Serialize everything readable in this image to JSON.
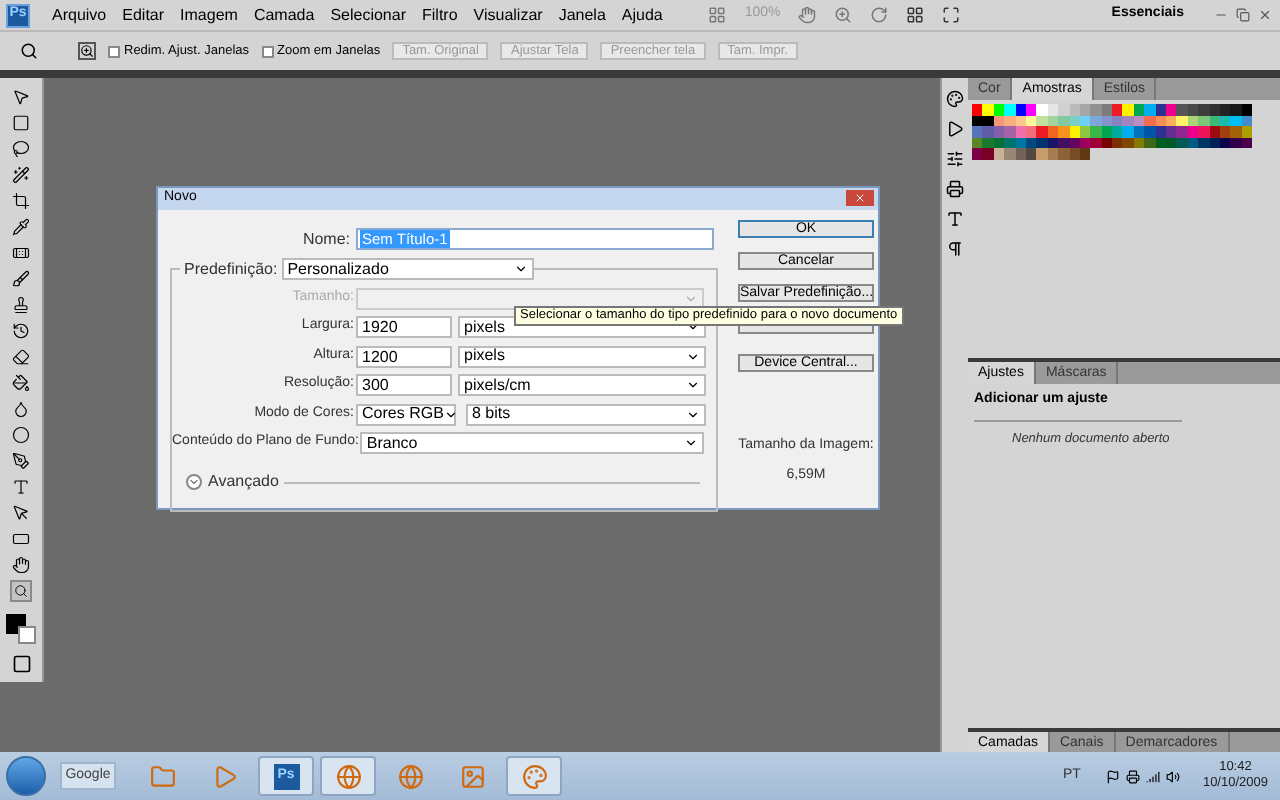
{
  "menubar": {
    "logo": "Ps",
    "menus": [
      "Arquivo",
      "Editar",
      "Imagem",
      "Camada",
      "Selecionar",
      "Filtro",
      "Visualizar",
      "Janela",
      "Ajuda"
    ],
    "zoom": "100%",
    "workspace": "Essenciais"
  },
  "options_bar": {
    "checkboxes": [
      {
        "label": "Redim. Ajust. Janelas",
        "checked": false
      },
      {
        "label": "Zoom em Janelas",
        "checked": false
      }
    ],
    "buttons": [
      "Tam. Original",
      "Ajustar Tela",
      "Preencher tela",
      "Tam. Impr."
    ]
  },
  "toolbox": {
    "tools": [
      {
        "selected": false
      },
      {
        "selected": false
      },
      {
        "selected": false
      },
      {
        "selected": false
      },
      {
        "selected": false
      },
      {
        "selected": false
      },
      {
        "selected": false
      },
      {
        "selected": false
      },
      {
        "selected": false
      },
      {
        "selected": false
      },
      {
        "selected": false
      },
      {
        "selected": false
      },
      {
        "selected": false
      },
      {
        "selected": false
      },
      {
        "selected": false
      },
      {
        "selected": false
      },
      {
        "selected": false
      },
      {
        "selected": false
      },
      {
        "selected": false
      },
      {
        "selected": true
      }
    ]
  },
  "dialog": {
    "title": "Novo",
    "name": {
      "label": "Nome:",
      "value": "Sem Título-1"
    },
    "preset": {
      "label": "Predefinição:",
      "value": "Personalizado"
    },
    "rows": [
      {
        "kind": "select",
        "label": "Tamanho:",
        "disabled": true
      },
      {
        "kind": "measure",
        "label": "Largura:",
        "value": "1920",
        "unit": "pixels",
        "disabled": false
      },
      {
        "kind": "measure",
        "label": "Altura:",
        "value": "1200",
        "unit": "pixels",
        "disabled": false
      },
      {
        "kind": "measure",
        "label": "Resolução:",
        "value": "300",
        "unit": "pixels/cm",
        "disabled": false
      },
      {
        "kind": "pair",
        "label": "Modo de Cores:",
        "value": "Cores RGB",
        "unit": "8 bits",
        "disabled": false
      },
      {
        "kind": "select",
        "label": "Conteúdo do Plano de Fundo:",
        "value": "Branco",
        "disabled": false
      }
    ],
    "advanced": {
      "label": "Avançado",
      "expanded": false
    },
    "buttons": [
      {
        "label": "OK",
        "default": true
      },
      {
        "label": "Cancelar",
        "default": false
      },
      {
        "label": "Salvar Predefinição...",
        "default": false
      },
      {
        "default": false
      },
      {
        "label": "Device Central...",
        "default": false
      }
    ],
    "image_size": {
      "label": "Tamanho da Imagem:",
      "value": "6,59M"
    },
    "tooltip": "Selecionar o tamanho do tipo predefinido para o novo documento"
  },
  "swatches_panel": {
    "tabs": [
      {
        "label": "Cor",
        "selected": false
      },
      {
        "label": "Amostras",
        "selected": true
      },
      {
        "label": "Estilos",
        "selected": false
      }
    ]
  },
  "adjustments_panel": {
    "tabs": [
      {
        "label": "Ajustes",
        "selected": true
      },
      {
        "label": "Máscaras",
        "selected": false
      }
    ],
    "heading": "Adicionar um ajuste",
    "message": "Nenhum documento aberto"
  },
  "layers_panel": {
    "tabs": [
      {
        "label": "Camadas",
        "selected": true
      },
      {
        "label": "Canais",
        "selected": false
      },
      {
        "label": "Demarcadores",
        "selected": false
      }
    ]
  },
  "taskbar": {
    "search": "Google",
    "apps": [
      {
        "selected": false
      },
      {
        "selected": false
      },
      {
        "label": "Ps",
        "selected": true
      },
      {
        "selected": true
      },
      {
        "selected": false
      },
      {
        "selected": false
      },
      {
        "selected": true
      }
    ],
    "language": "PT",
    "time": "10:42",
    "date": "10/10/2009"
  }
}
